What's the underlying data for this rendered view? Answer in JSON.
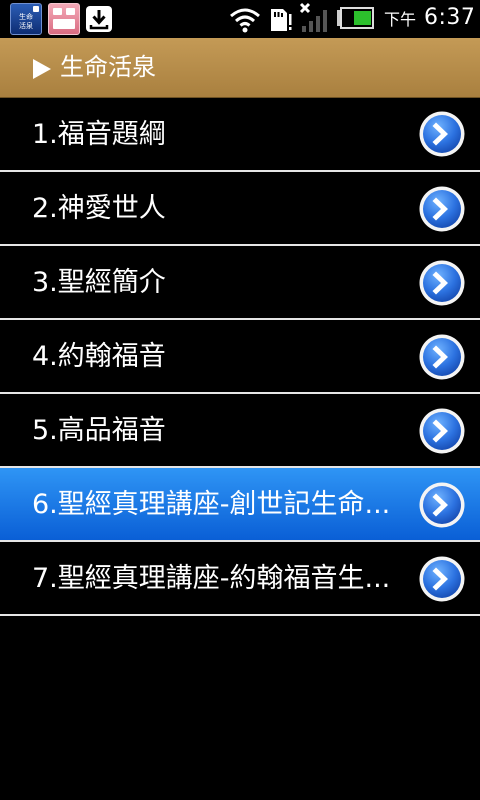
{
  "status_bar": {
    "notification_icons": [
      "app-icon",
      "gift-icon",
      "download-icon"
    ],
    "app1_text": "生命\n活泉",
    "time_prefix": "下午",
    "time": "6:37"
  },
  "header": {
    "title": "生命活泉",
    "color": "#b58c4a"
  },
  "list": {
    "items": [
      {
        "label": "1.福音題綱",
        "selected": false
      },
      {
        "label": "2.神愛世人",
        "selected": false
      },
      {
        "label": "3.聖經簡介",
        "selected": false
      },
      {
        "label": "4.約翰福音",
        "selected": false
      },
      {
        "label": "5.高品福音",
        "selected": false
      },
      {
        "label": "6.聖經真理講座-創世記生命...",
        "selected": true
      },
      {
        "label": "7.聖經真理講座-約翰福音生...",
        "selected": false
      }
    ],
    "selected_color": "#1673e6"
  }
}
